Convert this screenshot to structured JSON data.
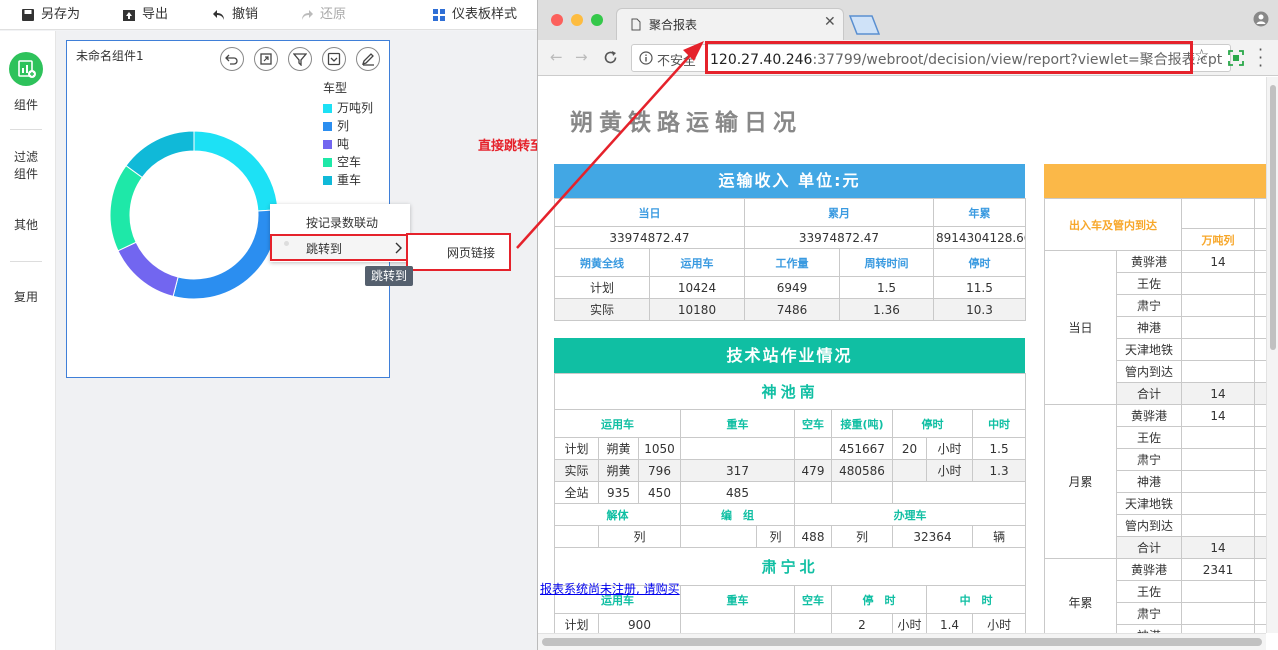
{
  "toolbar": {
    "save_as": "另存为",
    "export": "导出",
    "undo": "撤销",
    "redo": "还原",
    "dashboard_style": "仪表板样式"
  },
  "sidebar": {
    "items": [
      "组件",
      "过滤\n组件",
      "其他",
      "复用"
    ],
    "item_filter_line1": "过滤",
    "item_filter_line2": "组件"
  },
  "widget": {
    "title": "未命名组件1",
    "legend_title": "车型",
    "legend": [
      {
        "label": "万吨列",
        "color": "#1de1f5"
      },
      {
        "label": "列",
        "color": "#2b8ef0"
      },
      {
        "label": "吨",
        "color": "#7266f0"
      },
      {
        "label": "空车",
        "color": "#1ee8a8"
      },
      {
        "label": "重车",
        "color": "#10b9d8"
      }
    ]
  },
  "chart_data": {
    "type": "pie",
    "categories": [
      "万吨列",
      "列",
      "吨",
      "空车",
      "重车"
    ],
    "values": [
      0.24,
      0.3,
      0.14,
      0.17,
      0.15
    ],
    "colors": [
      "#1de1f5",
      "#2b8ef0",
      "#7266f0",
      "#1ee8a8",
      "#10b9d8"
    ],
    "legend_title": "车型",
    "legend_position": "right"
  },
  "context_menu": {
    "linkage": "按记录数联动",
    "jump": "跳转到",
    "submenu_web_link": "网页链接",
    "tooltip": "跳转到"
  },
  "annotation": "直接跳转至cpt模板",
  "browser": {
    "tab_title": "聚合报表",
    "insecure_label": "不安全",
    "url_host": "120.27.40.246",
    "url_rest": ":37799/webroot/decision/view/report?viewlet=聚合报表.cpt"
  },
  "report": {
    "title": "朔黄铁路运输日况",
    "income_header": "运输收入 单位:元",
    "income_cols": [
      "当日",
      "累月",
      "年累"
    ],
    "income_values": [
      "33974872.47",
      "33974872.47",
      "8914304128.66"
    ],
    "line_cols": [
      "朔黄全线",
      "运用车",
      "工作量",
      "周转时间",
      "停时"
    ],
    "line_rows": [
      [
        "计划",
        "10424",
        "6949",
        "1.5",
        "11.5"
      ],
      [
        "实际",
        "10180",
        "7486",
        "1.36",
        "10.3"
      ]
    ],
    "tech_header": "技术站作业情况",
    "station1": "神池南",
    "s1_cols": [
      "运用车",
      "重车",
      "空车",
      "接重(吨)",
      "停时",
      "中时"
    ],
    "s1_plan": [
      "计划",
      "朔黄",
      "1050",
      "",
      "",
      "451667",
      "20",
      "小时",
      "1.5",
      "小时"
    ],
    "s1_actual": [
      "实际",
      "朔黄",
      "796",
      "317",
      "479",
      "480586",
      "",
      "小时",
      "1.3",
      "小时"
    ],
    "s1_total": [
      "全站",
      "935",
      "450",
      "485"
    ],
    "s1_sub_cols": [
      "解体",
      "编　组",
      "办理车"
    ],
    "s1_sub_row": [
      "列",
      "列",
      "488",
      "列",
      "32364",
      "辆"
    ],
    "station2": "肃宁北",
    "s2_cols": [
      "运用车",
      "重车",
      "空车",
      "停　时",
      "中　时"
    ],
    "s2_plan": [
      "计划",
      "900",
      "2",
      "小时",
      "1.4",
      "小时"
    ],
    "register_link": "报表系统尚未注册, 请购买",
    "right_header": "出入车及管内到达",
    "right_col": "万吨列",
    "right_groups": [
      {
        "label": "当日",
        "rows": [
          [
            "黄骅港",
            "14"
          ],
          [
            "王佐",
            ""
          ],
          [
            "肃宁",
            ""
          ],
          [
            "神港",
            ""
          ],
          [
            "天津地铁",
            ""
          ],
          [
            "管内到达",
            ""
          ],
          [
            "合计",
            "14"
          ]
        ]
      },
      {
        "label": "月累",
        "rows": [
          [
            "黄骅港",
            "14"
          ],
          [
            "王佐",
            ""
          ],
          [
            "肃宁",
            ""
          ],
          [
            "神港",
            ""
          ],
          [
            "天津地铁",
            ""
          ],
          [
            "管内到达",
            ""
          ],
          [
            "合计",
            "14"
          ]
        ]
      },
      {
        "label": "年累",
        "rows": [
          [
            "黄骅港",
            "2341"
          ],
          [
            "王佐",
            ""
          ],
          [
            "肃宁",
            ""
          ],
          [
            "神港",
            ""
          ]
        ]
      }
    ]
  }
}
